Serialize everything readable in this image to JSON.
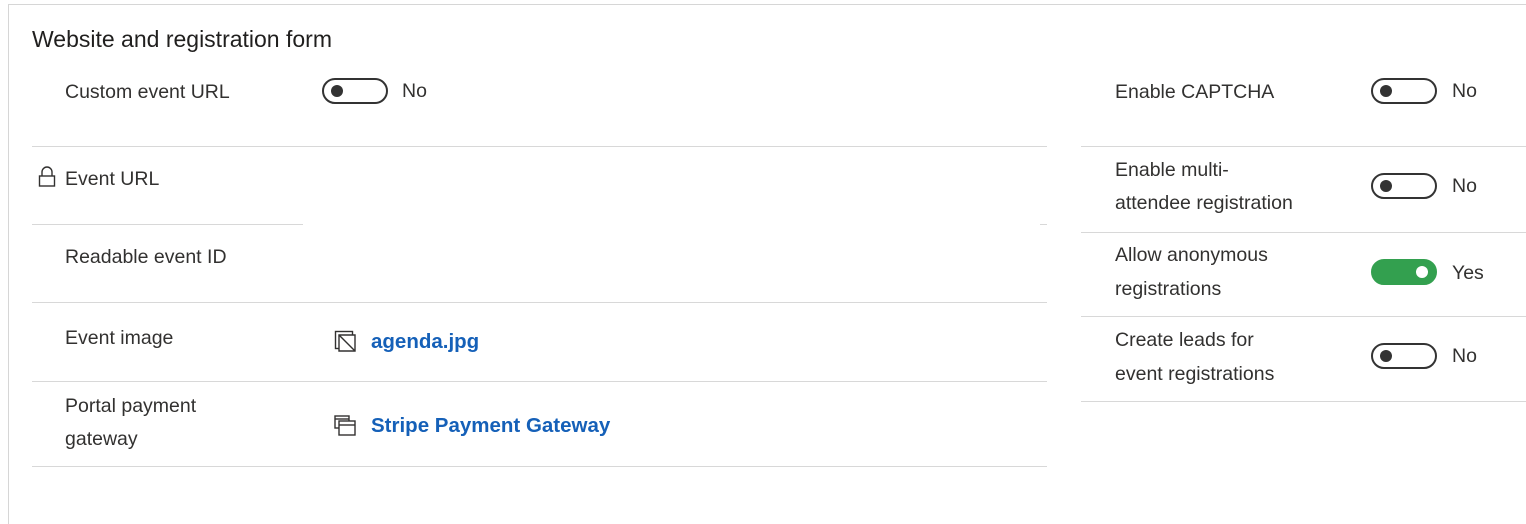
{
  "section": {
    "title": "Website and registration form"
  },
  "left_fields": {
    "custom_event_url": {
      "label": "Custom event URL",
      "toggle_text": "No",
      "value_on": false
    },
    "event_url": {
      "label": "Event URL",
      "lock_icon": "lock-icon"
    },
    "readable_event_id": {
      "label": "Readable event ID"
    },
    "event_image": {
      "label": "Event image",
      "link": "agenda.jpg",
      "icon": "image-file-icon"
    },
    "portal_payment_gateway": {
      "label_line1": "Portal payment",
      "label_line2": "gateway",
      "link": "Stripe Payment Gateway",
      "icon": "entity-record-icon"
    }
  },
  "right_fields": {
    "enable_captcha": {
      "label": "Enable CAPTCHA",
      "toggle_text": "No",
      "value_on": false
    },
    "enable_multi_attendee": {
      "label_line1": "Enable multi-",
      "label_line2": "attendee registration",
      "toggle_text": "No",
      "value_on": false
    },
    "allow_anonymous": {
      "label_line1": "Allow anonymous",
      "label_line2": "registrations",
      "toggle_text": "Yes",
      "value_on": true
    },
    "create_leads": {
      "label_line1": "Create leads for",
      "label_line2": "event registrations",
      "toggle_text": "No",
      "value_on": false
    }
  },
  "colors": {
    "toggle_on": "#33a04f",
    "link": "#1560b8",
    "divider": "#d8d8d8"
  }
}
